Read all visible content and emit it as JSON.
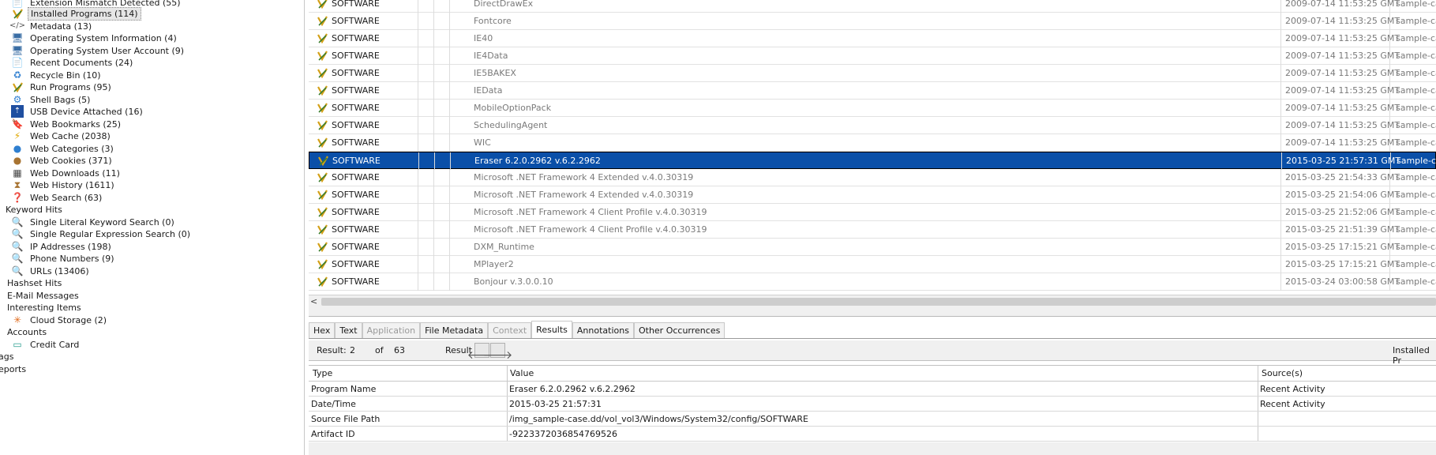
{
  "tree": {
    "items": [
      {
        "label": "Extension Mismatch Detected (55)",
        "icon": "warning-doc-icon",
        "level": 2
      },
      {
        "label": "Installed Programs (114)",
        "icon": "installed-programs-icon",
        "level": 2,
        "selected": true
      },
      {
        "label": "Metadata (13)",
        "icon": "code-tag-icon",
        "level": 2
      },
      {
        "label": "Operating System Information (4)",
        "icon": "computer-icon",
        "level": 2
      },
      {
        "label": "Operating System User Account (9)",
        "icon": "user-computer-icon",
        "level": 2
      },
      {
        "label": "Recent Documents (24)",
        "icon": "recent-doc-icon",
        "level": 2
      },
      {
        "label": "Recycle Bin (10)",
        "icon": "recycle-icon",
        "level": 2
      },
      {
        "label": "Run Programs (95)",
        "icon": "run-programs-icon",
        "level": 2
      },
      {
        "label": "Shell Bags (5)",
        "icon": "shell-bag-icon",
        "level": 2
      },
      {
        "label": "USB Device Attached (16)",
        "icon": "usb-icon",
        "level": 2
      },
      {
        "label": "Web Bookmarks (25)",
        "icon": "bookmark-icon",
        "level": 2
      },
      {
        "label": "Web Cache (2038)",
        "icon": "lightning-icon",
        "level": 2
      },
      {
        "label": "Web Categories (3)",
        "icon": "globe-icon",
        "level": 2
      },
      {
        "label": "Web Cookies (371)",
        "icon": "cookie-icon",
        "level": 2
      },
      {
        "label": "Web Downloads (11)",
        "icon": "download-icon",
        "level": 2
      },
      {
        "label": "Web History (1611)",
        "icon": "hourglass-icon",
        "level": 2
      },
      {
        "label": "Web Search (63)",
        "icon": "web-search-icon",
        "level": 2
      },
      {
        "label": "Keyword Hits",
        "icon": "",
        "level": 1
      },
      {
        "label": "Single Literal Keyword Search (0)",
        "icon": "magnifier-icon",
        "level": 2
      },
      {
        "label": "Single Regular Expression Search (0)",
        "icon": "magnifier-icon",
        "level": 2
      },
      {
        "label": "IP Addresses (198)",
        "icon": "magnifier-icon",
        "level": 2
      },
      {
        "label": "Phone Numbers (9)",
        "icon": "magnifier-icon",
        "level": 2
      },
      {
        "label": "URLs (13406)",
        "icon": "magnifier-icon",
        "level": 2
      },
      {
        "label": "Hashset Hits",
        "icon": "",
        "level": 1
      },
      {
        "label": "E-Mail Messages",
        "icon": "",
        "level": 1
      },
      {
        "label": "Interesting Items",
        "icon": "",
        "level": 1
      },
      {
        "label": "Cloud Storage (2)",
        "icon": "cloud-storage-icon",
        "level": 2
      },
      {
        "label": "Accounts",
        "icon": "",
        "level": 1
      },
      {
        "label": "Credit Card",
        "icon": "credit-card-icon",
        "level": 2
      },
      {
        "label": "ags",
        "icon": "",
        "level": 0
      },
      {
        "label": "eports",
        "icon": "",
        "level": 0
      }
    ]
  },
  "grid": {
    "rows": [
      {
        "source": "SOFTWARE",
        "name": "DirectDrawEx",
        "date": "2009-07-14 11:53:25 GMT",
        "data_source": "sample-ca"
      },
      {
        "source": "SOFTWARE",
        "name": "Fontcore",
        "date": "2009-07-14 11:53:25 GMT",
        "data_source": "sample-ca"
      },
      {
        "source": "SOFTWARE",
        "name": "IE40",
        "date": "2009-07-14 11:53:25 GMT",
        "data_source": "sample-ca"
      },
      {
        "source": "SOFTWARE",
        "name": "IE4Data",
        "date": "2009-07-14 11:53:25 GMT",
        "data_source": "sample-ca"
      },
      {
        "source": "SOFTWARE",
        "name": "IE5BAKEX",
        "date": "2009-07-14 11:53:25 GMT",
        "data_source": "sample-ca"
      },
      {
        "source": "SOFTWARE",
        "name": "IEData",
        "date": "2009-07-14 11:53:25 GMT",
        "data_source": "sample-ca"
      },
      {
        "source": "SOFTWARE",
        "name": "MobileOptionPack",
        "date": "2009-07-14 11:53:25 GMT",
        "data_source": "sample-ca"
      },
      {
        "source": "SOFTWARE",
        "name": "SchedulingAgent",
        "date": "2009-07-14 11:53:25 GMT",
        "data_source": "sample-ca"
      },
      {
        "source": "SOFTWARE",
        "name": "WIC",
        "date": "2009-07-14 11:53:25 GMT",
        "data_source": "sample-ca"
      },
      {
        "source": "SOFTWARE",
        "name": "Eraser 6.2.0.2962 v.6.2.2962",
        "date": "2015-03-25 21:57:31 GMT",
        "data_source": "sample-ca",
        "selected": true
      },
      {
        "source": "SOFTWARE",
        "name": "Microsoft .NET Framework 4 Extended v.4.0.30319",
        "date": "2015-03-25 21:54:33 GMT",
        "data_source": "sample-ca"
      },
      {
        "source": "SOFTWARE",
        "name": "Microsoft .NET Framework 4 Extended v.4.0.30319",
        "date": "2015-03-25 21:54:06 GMT",
        "data_source": "sample-ca"
      },
      {
        "source": "SOFTWARE",
        "name": "Microsoft .NET Framework 4 Client Profile v.4.0.30319",
        "date": "2015-03-25 21:52:06 GMT",
        "data_source": "sample-ca"
      },
      {
        "source": "SOFTWARE",
        "name": "Microsoft .NET Framework 4 Client Profile v.4.0.30319",
        "date": "2015-03-25 21:51:39 GMT",
        "data_source": "sample-ca"
      },
      {
        "source": "SOFTWARE",
        "name": "DXM_Runtime",
        "date": "2015-03-25 17:15:21 GMT",
        "data_source": "sample-ca"
      },
      {
        "source": "SOFTWARE",
        "name": "MPlayer2",
        "date": "2015-03-25 17:15:21 GMT",
        "data_source": "sample-ca"
      },
      {
        "source": "SOFTWARE",
        "name": "Bonjour v.3.0.0.10",
        "date": "2015-03-24 03:00:58 GMT",
        "data_source": "sample-ca"
      }
    ]
  },
  "tabs": [
    {
      "label": "Hex",
      "state": "normal"
    },
    {
      "label": "Text",
      "state": "normal"
    },
    {
      "label": "Application",
      "state": "disabled"
    },
    {
      "label": "File Metadata",
      "state": "normal"
    },
    {
      "label": "Context",
      "state": "disabled"
    },
    {
      "label": "Results",
      "state": "active"
    },
    {
      "label": "Annotations",
      "state": "normal"
    },
    {
      "label": "Other Occurrences",
      "state": "normal"
    }
  ],
  "result_nav": {
    "result_label": "Result:",
    "current": "2",
    "of_label": "of",
    "total": "63",
    "result_word": "Result",
    "right_label": "Installed Pr"
  },
  "results_table": {
    "headers": {
      "type": "Type",
      "value": "Value",
      "sources": "Source(s)"
    },
    "rows": [
      {
        "type": "Program Name",
        "value": "Eraser 6.2.0.2962 v.6.2.2962",
        "source": "Recent Activity"
      },
      {
        "type": "Date/Time",
        "value": "2015-03-25 21:57:31",
        "source": "Recent Activity"
      },
      {
        "type": "Source File Path",
        "value": "/img_sample-case.dd/vol_vol3/Windows/System32/config/SOFTWARE",
        "source": ""
      },
      {
        "type": "Artifact ID",
        "value": "-9223372036854769526",
        "source": ""
      }
    ]
  },
  "colors": {
    "selection": "#0a4fa8",
    "tree_selection": "#e6e6e6",
    "panel_bg": "#f0f0f0"
  }
}
